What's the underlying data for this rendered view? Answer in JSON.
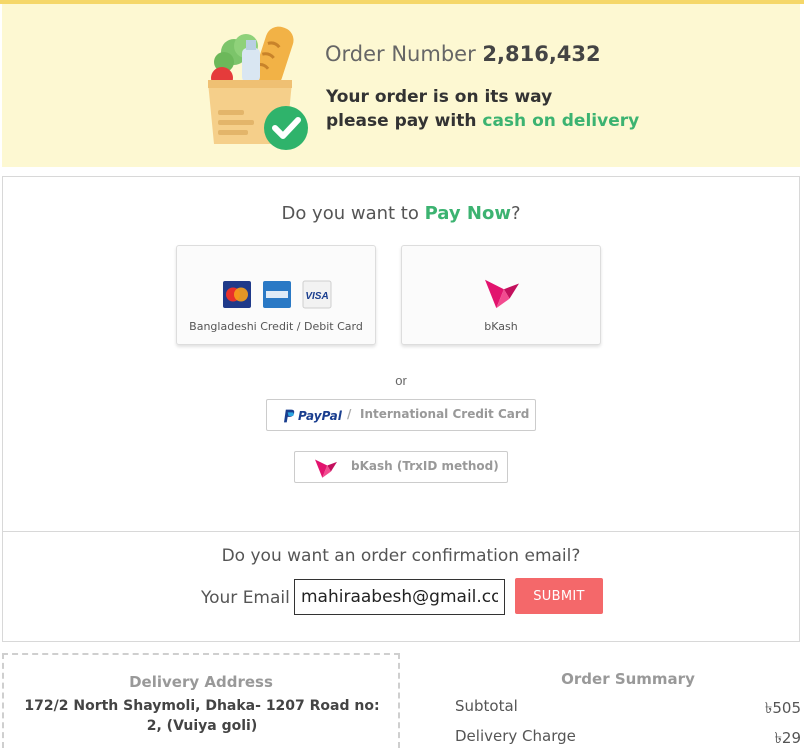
{
  "banner": {
    "order_label": "Order Number",
    "order_number": "2,816,432",
    "status_line1": "Your order is on its way",
    "status_line2_prefix": "please pay with",
    "status_line2_highlight": "cash on delivery"
  },
  "payment": {
    "question_prefix": "Do you want to",
    "question_highlight": "Pay Now",
    "question_suffix": "?",
    "card_option_label": "Bangladeshi Credit / Debit Card",
    "card_logos": [
      "MasterCard",
      "AMERICAN EXPRESS",
      "VISA"
    ],
    "bkash_option_label": "bKash",
    "or_text": "or",
    "paypal_brand": "PayPal",
    "paypal_separator": "/",
    "paypal_label": "International Credit Card",
    "bkash_trx_label": "bKash (TrxID method)"
  },
  "email": {
    "question": "Do you want an order confirmation email?",
    "label": "Your Email",
    "value": "mahiraabesh@gmail.com",
    "submit_label": "SUBMIT"
  },
  "delivery": {
    "title": "Delivery Address",
    "address": "172/2 North Shaymoli, Dhaka- 1207 Road no: 2, (Vuiya goli)"
  },
  "summary": {
    "title": "Order Summary",
    "rows": [
      {
        "label": "Subtotal",
        "amount": "৳505"
      },
      {
        "label": "Delivery Charge",
        "amount": "৳29"
      }
    ]
  },
  "colors": {
    "accent_green": "#3cb371",
    "submit_red": "#f4686a",
    "banner_bg": "#fdf8d2",
    "bkash_pink": "#e2136e"
  }
}
